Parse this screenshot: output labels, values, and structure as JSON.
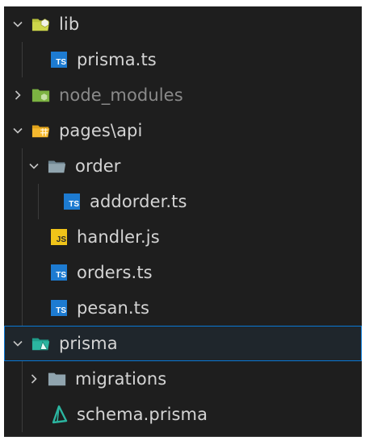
{
  "tree": {
    "lib": {
      "label": "lib",
      "expanded": true,
      "icon": "folder-lib-open-icon"
    },
    "prisma_ts": {
      "label": "prisma.ts",
      "icon": "typescript-file-icon",
      "badge": "TS"
    },
    "node_modules": {
      "label": "node_modules",
      "expanded": false,
      "icon": "folder-node-icon"
    },
    "pages_api": {
      "label": "pages\\api",
      "expanded": true,
      "icon": "folder-pages-open-icon"
    },
    "order": {
      "label": "order",
      "expanded": true,
      "icon": "folder-open-icon"
    },
    "addorder_ts": {
      "label": "addorder.ts",
      "icon": "typescript-file-icon",
      "badge": "TS"
    },
    "handler_js": {
      "label": "handler.js",
      "icon": "javascript-file-icon",
      "badge": "JS"
    },
    "orders_ts": {
      "label": "orders.ts",
      "icon": "typescript-file-icon",
      "badge": "TS"
    },
    "pesan_ts": {
      "label": "pesan.ts",
      "icon": "typescript-file-icon",
      "badge": "TS"
    },
    "prisma": {
      "label": "prisma",
      "expanded": true,
      "selected": true,
      "icon": "folder-prisma-open-icon"
    },
    "migrations": {
      "label": "migrations",
      "expanded": false,
      "icon": "folder-icon"
    },
    "schema_prisma": {
      "label": "schema.prisma",
      "icon": "prisma-file-icon"
    }
  },
  "colors": {
    "background": "#1e1e1e",
    "text": "#d4d4d4",
    "dim_text": "#8a8a8a",
    "selection_border": "#0a78d4",
    "ts_badge": "#1d7bd1",
    "js_badge": "#f0c419",
    "prisma_icon": "#2bb5a0"
  }
}
